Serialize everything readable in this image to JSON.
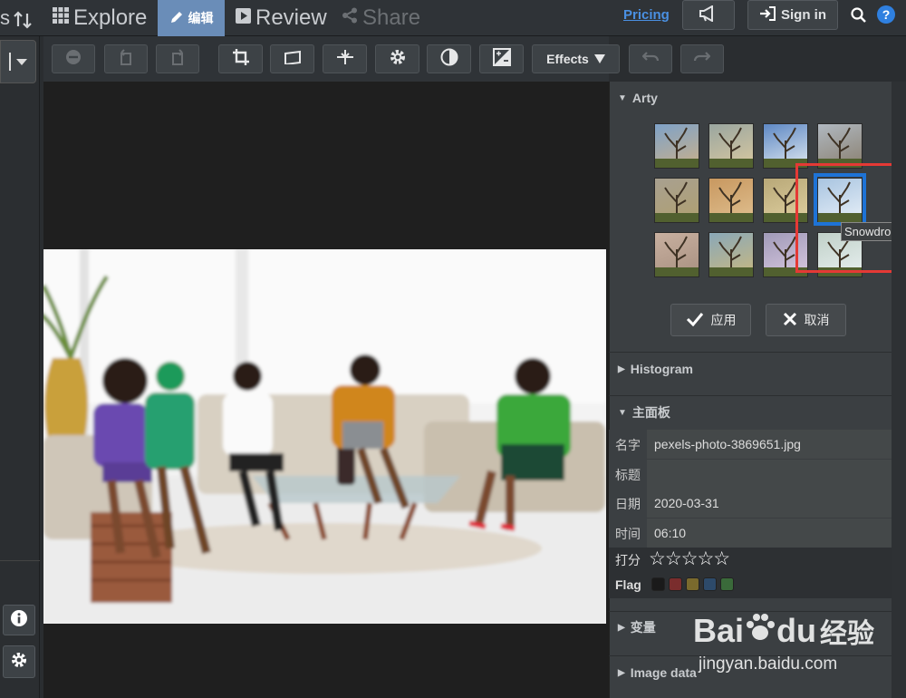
{
  "topbar": {
    "left_fragment": "s",
    "explore_label": "Explore",
    "edit_label": "编辑",
    "review_label": "Review",
    "share_label": "Share",
    "pricing_label": "Pricing",
    "signin_label": "Sign in"
  },
  "toolbar": {
    "effects_label": "Effects"
  },
  "icons": {
    "sort": "sort-arrows-icon",
    "grid": "grid-icon",
    "pencil": "pencil-icon",
    "play": "play-icon",
    "share": "share-icon",
    "megaphone": "megaphone-icon",
    "signin": "sign-in-icon",
    "search": "search-icon",
    "help": "help-icon",
    "info": "info-icon",
    "gear": "gear-icon"
  },
  "panel": {
    "arty_title": "Arty",
    "tooltip": "Snowdrop",
    "apply_label": "应用",
    "cancel_label": "取消",
    "histogram_title": "Histogram",
    "main_title": "主面板",
    "variables_title": "变量",
    "image_data_title": "Image data",
    "fields": [
      {
        "label": "名字",
        "value": "pexels-photo-3869651.jpg"
      },
      {
        "label": "标题",
        "value": ""
      },
      {
        "label": "日期",
        "value": "2020-03-31"
      },
      {
        "label": "时间",
        "value": "06:10"
      }
    ],
    "rating_label": "打分",
    "rating_stars": "☆☆☆☆☆",
    "rating_value": 0,
    "flag_label": "Flag",
    "flag_colors": [
      "#1a1a1a",
      "#7a2d2d",
      "#7a6a2d",
      "#2d4a6a",
      "#3a6a3a"
    ]
  },
  "watermark": {
    "brand_a": "Bai",
    "brand_b": "du",
    "brand_cn": "经验",
    "url": "jingyan.baidu.com"
  },
  "colors": {
    "accent": "#1e73d6",
    "highlight": "#e53935",
    "edit_tab": "#6a8db8",
    "pricing": "#4a90e2"
  }
}
